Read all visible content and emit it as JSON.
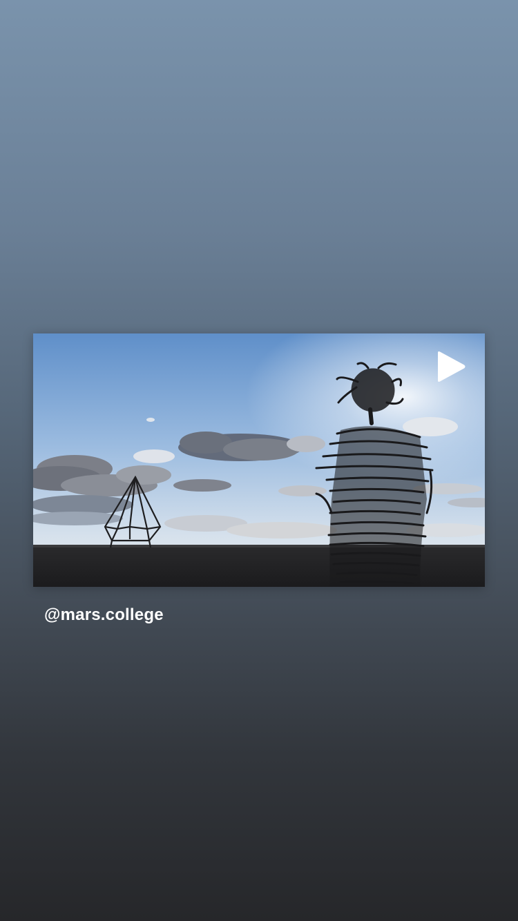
{
  "story": {
    "background": {
      "top_color": "#7a93ac",
      "bottom_color": "#26272a"
    }
  },
  "media_card": {
    "type": "video",
    "content": "sky-landscape-with-wire-sculptures",
    "play_icon": "play-icon"
  },
  "mention": {
    "handle": "@mars.college"
  }
}
